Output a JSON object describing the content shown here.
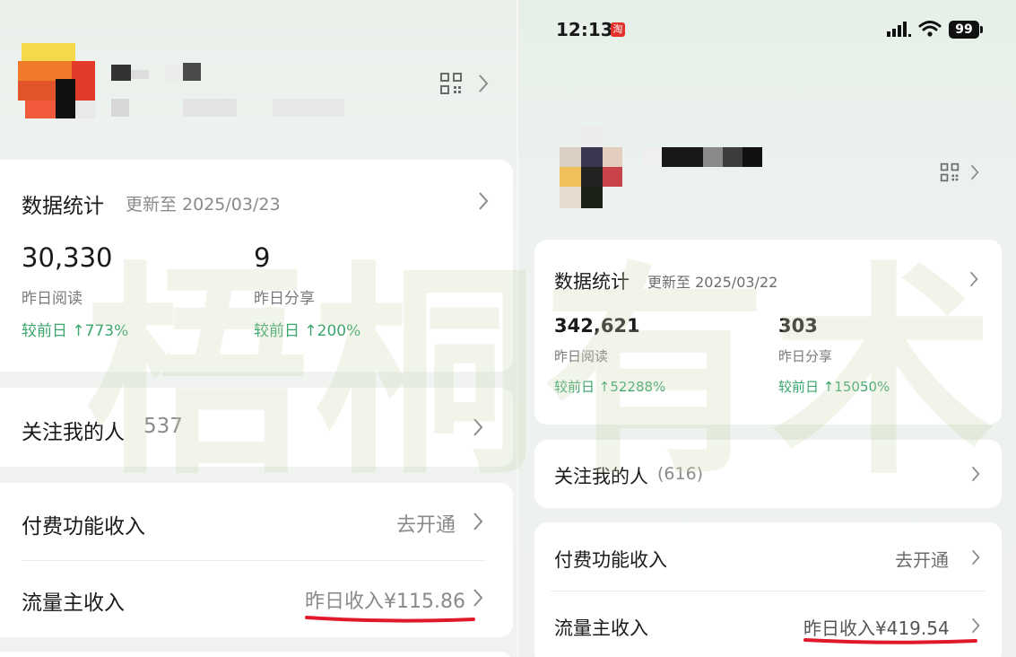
{
  "watermark": "梧桐有术",
  "colors": {
    "accent_green": "#3aa66b",
    "underline_red": "#e0192b",
    "card_bg": "#ffffff"
  },
  "left": {
    "stats": {
      "title": "数据统计",
      "updated": "更新至 2025/03/23",
      "reads_value": "30,330",
      "reads_label": "昨日阅读",
      "reads_change": "较前日 ↑773%",
      "shares_value": "9",
      "shares_label": "昨日分享",
      "shares_change": "较前日 ↑200%"
    },
    "followers": {
      "label": "关注我的人",
      "count": "537"
    },
    "paid": {
      "label": "付费功能收入",
      "action": "去开通"
    },
    "traffic": {
      "label": "流量主收入",
      "value": "昨日收入¥115.86"
    }
  },
  "right": {
    "status_bar": {
      "time": "12:13",
      "app_badge": "淘",
      "battery": "99"
    },
    "stats": {
      "title": "数据统计",
      "updated": "更新至 2025/03/22",
      "reads_value": "342,621",
      "reads_label": "昨日阅读",
      "reads_change": "较前日 ↑52288%",
      "shares_value": "303",
      "shares_label": "昨日分享",
      "shares_change": "较前日 ↑15050%"
    },
    "followers": {
      "label": "关注我的人",
      "count": "(616)"
    },
    "paid": {
      "label": "付费功能收入",
      "action": "去开通"
    },
    "traffic": {
      "label": "流量主收入",
      "value": "昨日收入¥419.54"
    }
  },
  "icons": [
    "qr-code-icon",
    "chevron-right-icon",
    "signal-icon",
    "wifi-icon",
    "battery-icon"
  ]
}
